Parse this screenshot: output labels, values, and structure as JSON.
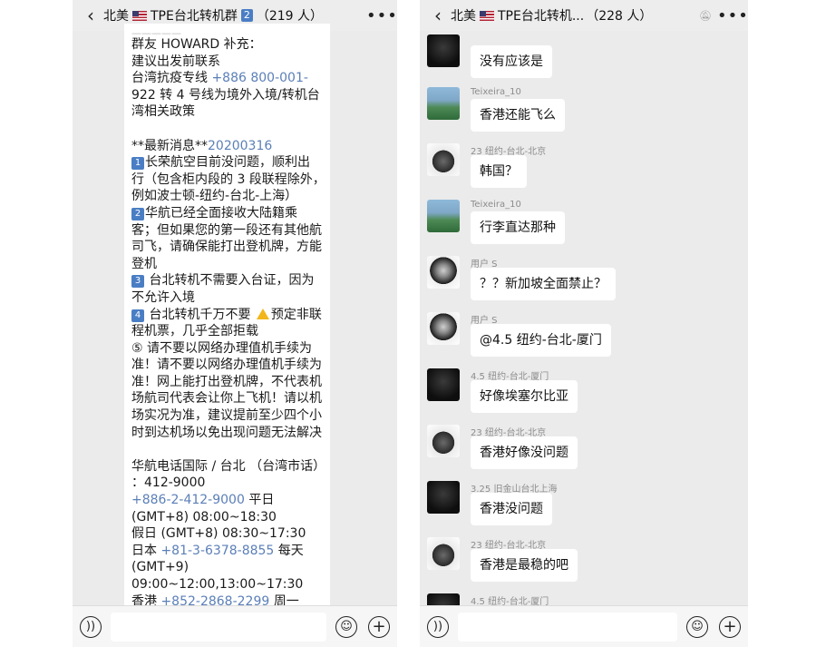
{
  "left": {
    "back_icon": "chevron-left",
    "title_prefix": "北美",
    "title_tpe": "TPE台北转机群",
    "title_badge": "2",
    "title_count": "（219 人）",
    "more_icon": "more-dots",
    "lines": [
      "群友 HOWARD 补充：",
      "建议出发前联系",
      " 台湾抗疫专线 ",
      "922 转 4 号线为境外入境/转机台",
      "湾相关政策",
      "",
      "**最新消息**",
      "长荣航空目前没问题，顺利出",
      "行（包含柜内段的 3 段联程除外，",
      "例如波士顿-纽约-台北-上海）",
      "华航已经全面接收大陆籍乘",
      "客；但如果您的第一段还有其他航",
      "司飞，请确保能打出登机牌，方能",
      "登机",
      " 台北转机不需要入台证，因为",
      "不允许入境",
      " 台北转机千万不要 ",
      "预定非联",
      "程机票，几乎全部拒载",
      "⑤ 请不要以网络办理值机手续为",
      "准！请不要以网络办理值机手续为",
      "准！网上能打出登机牌，不代表机",
      "场航司代表会让你上飞机！请以机",
      "场实况为准，建议提前至少四个小",
      "时到达机场以免出现问题无法解决",
      "",
      "华航电话国际 / 台北 （台湾市话）",
      "：412-9000",
      " 平日",
      "(GMT+8) 08:00~18:30",
      "假日 (GMT+8) 08:30~17:30",
      "日本 ",
      " 每天",
      "(GMT+9)",
      "09:00~12:00,13:00~17:30",
      "香港 ",
      " 周一"
    ],
    "phone_tw": "+886 800-001-",
    "date_tag": "20200316",
    "num_1": "1",
    "num_2": "2",
    "num_3": "3",
    "num_4": "4",
    "phone_cal": "+886-2-412-9000",
    "phone_jp": "+81-3-6378-8855",
    "phone_hk": "+852-2868-2299",
    "voice_icon": "voice-icon",
    "emoji_icon": "emoji-icon",
    "plus_icon": "plus-icon"
  },
  "right": {
    "back_icon": "chevron-left",
    "title_prefix": "北美",
    "title_tpe": "TPE台北转机...",
    "title_count": "（228 人）",
    "mute_icon": "bell-muted",
    "more_icon": "more-dots",
    "messages": [
      {
        "name": "",
        "text": "没有应该是"
      },
      {
        "name": "Teixeira_10",
        "text": "香港还能飞么"
      },
      {
        "name": "23 纽约-台北-北京",
        "text": "韩国？"
      },
      {
        "name": "Teixeira_10",
        "text": "行李直达那种"
      },
      {
        "name": "用户 S",
        "text": "？？新加坡全面禁止？"
      },
      {
        "name": "用户 S",
        "text": "@4.5 纽约-台北-厦门"
      },
      {
        "name": "4.5 纽约-台北-厦门",
        "text": "好像埃塞尔比亚"
      },
      {
        "name": "23 纽约-台北-北京",
        "text": "香港好像没问题"
      },
      {
        "name": "3.25 旧金山台北上海",
        "text": "香港没问题"
      },
      {
        "name": "23 纽约-台北-北京",
        "text": "香港是最稳的吧"
      },
      {
        "name": "4.5 纽约-台北-厦门",
        "text": ""
      }
    ]
  }
}
